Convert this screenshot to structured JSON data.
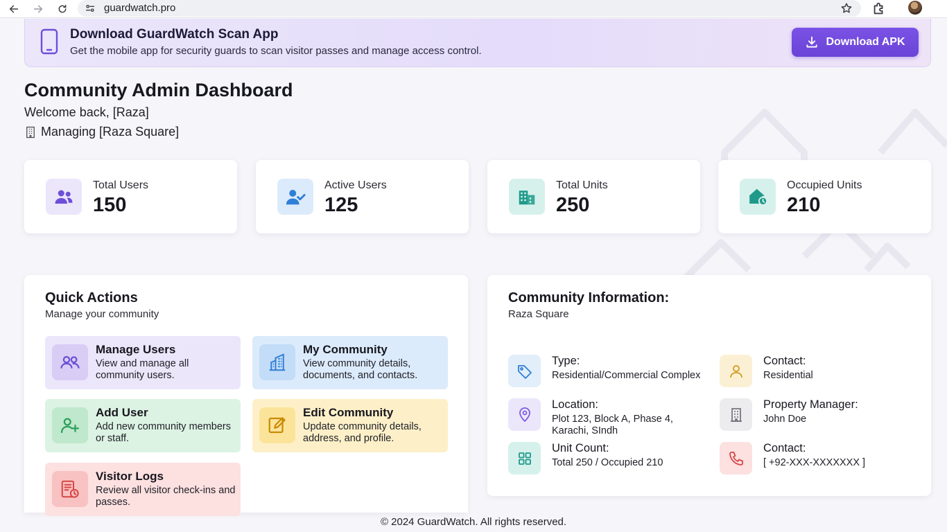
{
  "browser": {
    "url": "guardwatch.pro"
  },
  "banner": {
    "title": "Download GuardWatch Scan App",
    "description": "Get the mobile app for security guards to scan visitor passes and manage access control.",
    "button_label": "Download APK"
  },
  "header": {
    "title": "Community Admin Dashboard",
    "welcome": "Welcome back, [Raza]",
    "managing": "Managing [Raza Square]"
  },
  "stats": [
    {
      "label": "Total Users",
      "value": "150",
      "icon": "users-icon",
      "color": "#7c5ce0"
    },
    {
      "label": "Active Users",
      "value": "125",
      "icon": "user-check-icon",
      "color": "#2f7fd8"
    },
    {
      "label": "Total Units",
      "value": "250",
      "icon": "building-icon",
      "color": "#1f9a8a"
    },
    {
      "label": "Occupied Units",
      "value": "210",
      "icon": "home-clock-icon",
      "color": "#1f9a8a"
    }
  ],
  "quick_actions": {
    "title": "Quick Actions",
    "subtitle": "Manage your community",
    "items": [
      {
        "title": "Manage Users",
        "description": "View and manage all community users.",
        "icon": "users-icon",
        "bg": "#ece6fb"
      },
      {
        "title": "My Community",
        "description": "View community details, documents, and contacts.",
        "icon": "city-icon",
        "bg": "#dcebfb"
      },
      {
        "title": "Add User",
        "description": "Add new community members or staff.",
        "icon": "user-plus-icon",
        "bg": "#dcf3e3"
      },
      {
        "title": "Edit Community",
        "description": "Update community details, address, and profile.",
        "icon": "edit-icon",
        "bg": "#fdf0c8"
      },
      {
        "title": "Visitor Logs",
        "description": "Review all visitor check-ins and passes.",
        "icon": "log-clock-icon",
        "bg": "#fde0e0"
      }
    ]
  },
  "community_info": {
    "title": "Community Information:",
    "subtitle": "Raza Square",
    "items": [
      {
        "label": "Type:",
        "value": "Residential/Commercial Complex",
        "icon": "tag-icon"
      },
      {
        "label": "Contact:",
        "value": "Residential",
        "icon": "person-icon"
      },
      {
        "label": "Location:",
        "value": "Plot 123, Block A, Phase 4, Karachi, SIndh",
        "icon": "location-pin-icon"
      },
      {
        "label": "Property Manager:",
        "value": "John Doe",
        "icon": "office-building-icon"
      },
      {
        "label": "Unit Count:",
        "value": "Total 250 / Occupied 210",
        "icon": "grid-icon"
      },
      {
        "label": "Contact:",
        "value": "[ +92-XXX-XXXXXXX ]",
        "icon": "phone-icon"
      }
    ]
  },
  "footer": {
    "text": "© 2024 GuardWatch. All rights reserved."
  }
}
